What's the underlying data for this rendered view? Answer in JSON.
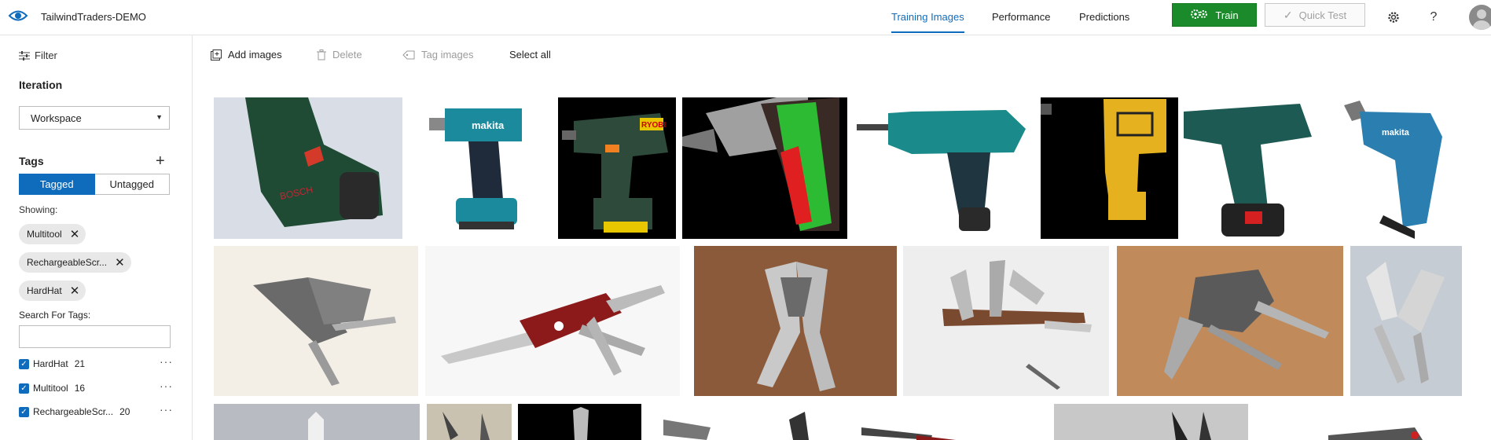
{
  "header": {
    "project_name": "TailwindTraders-DEMO",
    "tabs": [
      {
        "label": "Training Images",
        "active": true
      },
      {
        "label": "Performance",
        "active": false
      },
      {
        "label": "Predictions",
        "active": false
      }
    ],
    "train_label": "Train",
    "quick_test_label": "Quick Test",
    "help_glyph": "?",
    "accent_color": "#0f6cbd",
    "train_color": "#1a8a2a"
  },
  "sidebar": {
    "filter_label": "Filter",
    "iteration_title": "Iteration",
    "iteration_value": "Workspace",
    "tags_title": "Tags",
    "toggle": {
      "tagged": "Tagged",
      "untagged": "Untagged",
      "selected": "Tagged"
    },
    "showing_label": "Showing:",
    "chips": [
      "Multitool",
      "RechargeableScr...",
      "HardHat"
    ],
    "search_label": "Search For Tags:",
    "search_value": "",
    "tags": [
      {
        "name": "HardHat",
        "count": "21",
        "checked": true
      },
      {
        "name": "Multitool",
        "count": "16",
        "checked": true
      },
      {
        "name": "RechargeableScr...",
        "count": "20",
        "checked": true
      }
    ]
  },
  "toolbar": {
    "add_images": "Add images",
    "delete": "Delete",
    "tag_images": "Tag images",
    "select_all": "Select all"
  },
  "gallery": {
    "row1_subjects": [
      "drill",
      "impact-driver",
      "drill",
      "screwdriver",
      "drill",
      "drill-silhouette",
      "drill",
      "drill"
    ],
    "row2_subjects": [
      "multitool",
      "swiss-knife",
      "multitool",
      "pocket-knife",
      "multitool",
      "multitool"
    ],
    "row3_subjects": [
      "multitool",
      "multitool",
      "multitool",
      "multitool",
      "multitool",
      "multitool",
      "multitool"
    ]
  }
}
